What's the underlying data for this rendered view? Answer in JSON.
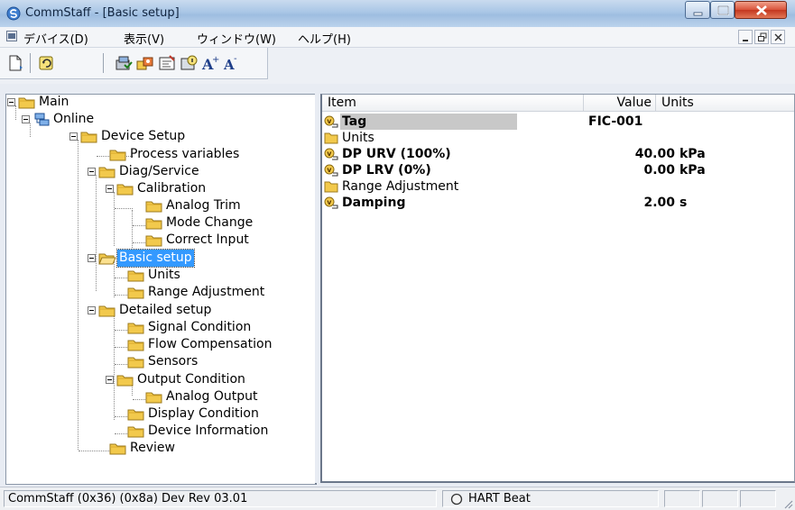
{
  "window": {
    "title": "CommStaff - [Basic setup]"
  },
  "menu": {
    "items": [
      "デバイス(D)",
      "表示(V)",
      "ウィンドウ(W)",
      "ヘルプ(H)"
    ]
  },
  "tree": {
    "main": "Main",
    "online": "Online",
    "device_setup": "Device Setup",
    "process_variables": "Process variables",
    "diag_service": "Diag/Service",
    "calibration": "Calibration",
    "analog_trim": "Analog Trim",
    "mode_change": "Mode Change",
    "correct_input": "Correct Input",
    "basic_setup": "Basic setup",
    "units": "Units",
    "range_adjustment": "Range Adjustment",
    "detailed_setup": "Detailed setup",
    "signal_condition": "Signal Condition",
    "flow_compensation": "Flow Compensation",
    "sensors": "Sensors",
    "output_condition": "Output Condition",
    "analog_output": "Analog Output",
    "display_condition": "Display Condition",
    "device_information": "Device Information",
    "review": "Review"
  },
  "list": {
    "headers": {
      "item": "Item",
      "value": "Value",
      "units": "Units"
    },
    "rows": [
      {
        "item": "Tag",
        "value": "FIC-001",
        "unit": ""
      },
      {
        "item": "Units",
        "value": "",
        "unit": ""
      },
      {
        "item": "DP URV (100%)",
        "value": "40.00",
        "unit": "kPa"
      },
      {
        "item": "DP LRV (0%)",
        "value": "0.00",
        "unit": "kPa"
      },
      {
        "item": "Range Adjustment",
        "value": "",
        "unit": ""
      },
      {
        "item": "Damping",
        "value": "2.00",
        "unit": "s"
      }
    ]
  },
  "status": {
    "device": "CommStaff  (0x36)  (0x8a) Dev Rev 03.01",
    "heartbeat": "HART Beat"
  },
  "colors": {
    "selection": "#3399ff",
    "folder": "#f2c94c",
    "titlebar": "#b4cde9"
  }
}
